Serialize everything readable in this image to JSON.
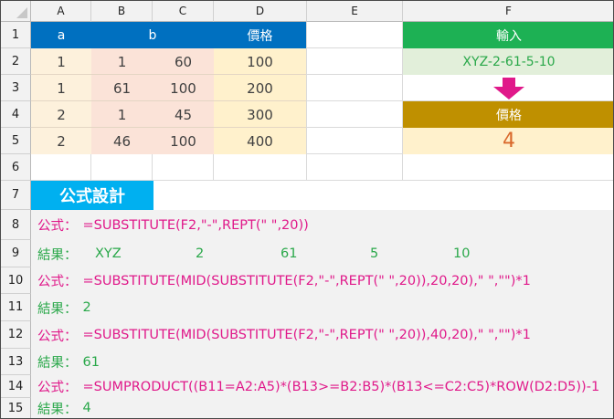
{
  "columns": [
    "A",
    "B",
    "C",
    "D",
    "E",
    "F"
  ],
  "rows": [
    "1",
    "2",
    "3",
    "4",
    "5",
    "6",
    "7",
    "8",
    "9",
    "10",
    "11",
    "12",
    "13",
    "14",
    "15"
  ],
  "table": {
    "headers": {
      "a": "a",
      "b": "b",
      "price": "價格"
    },
    "data": [
      [
        "1",
        "1",
        "60",
        "100"
      ],
      [
        "1",
        "61",
        "100",
        "200"
      ],
      [
        "2",
        "1",
        "45",
        "300"
      ],
      [
        "2",
        "46",
        "100",
        "400"
      ]
    ]
  },
  "input": {
    "header": "輸入",
    "value": "XYZ-2-61-5-10"
  },
  "price_output": {
    "header": "價格",
    "value": "4"
  },
  "formula_title": "公式設計",
  "labels": {
    "formula": "公式：",
    "result": "結果："
  },
  "rows_content": {
    "f8": "=SUBSTITUTE(F2,\"-\",REPT(\" \",20))",
    "r9": [
      "XYZ",
      "2",
      "61",
      "5",
      "10"
    ],
    "f10": "=SUBSTITUTE(MID(SUBSTITUTE(F2,\"-\",REPT(\" \",20)),20,20),\" \",\"\")*1",
    "r11": "2",
    "f12": "=SUBSTITUTE(MID(SUBSTITUTE(F2,\"-\",REPT(\" \",20)),40,20),\" \",\"\")*1",
    "r13": "61",
    "f14": "=SUMPRODUCT((B11=A2:A5)*(B13>=B2:B5)*(B13<=C2:C5)*ROW(D2:D5))-1",
    "r15": "4"
  },
  "colors": {
    "header_blue": "#0070c0",
    "header_green": "#1db154",
    "header_gold": "#bf9000",
    "fill_a": "#fdf1dc",
    "fill_bc": "#fbe3d8",
    "fill_d": "#fff1cc",
    "input_fill": "#e2efda",
    "output_fill": "#fff1cc",
    "arrow": "#e0198a",
    "title_bg": "#00b0f0",
    "formula_pink": "#e0198a",
    "result_green": "#2aa84a"
  }
}
